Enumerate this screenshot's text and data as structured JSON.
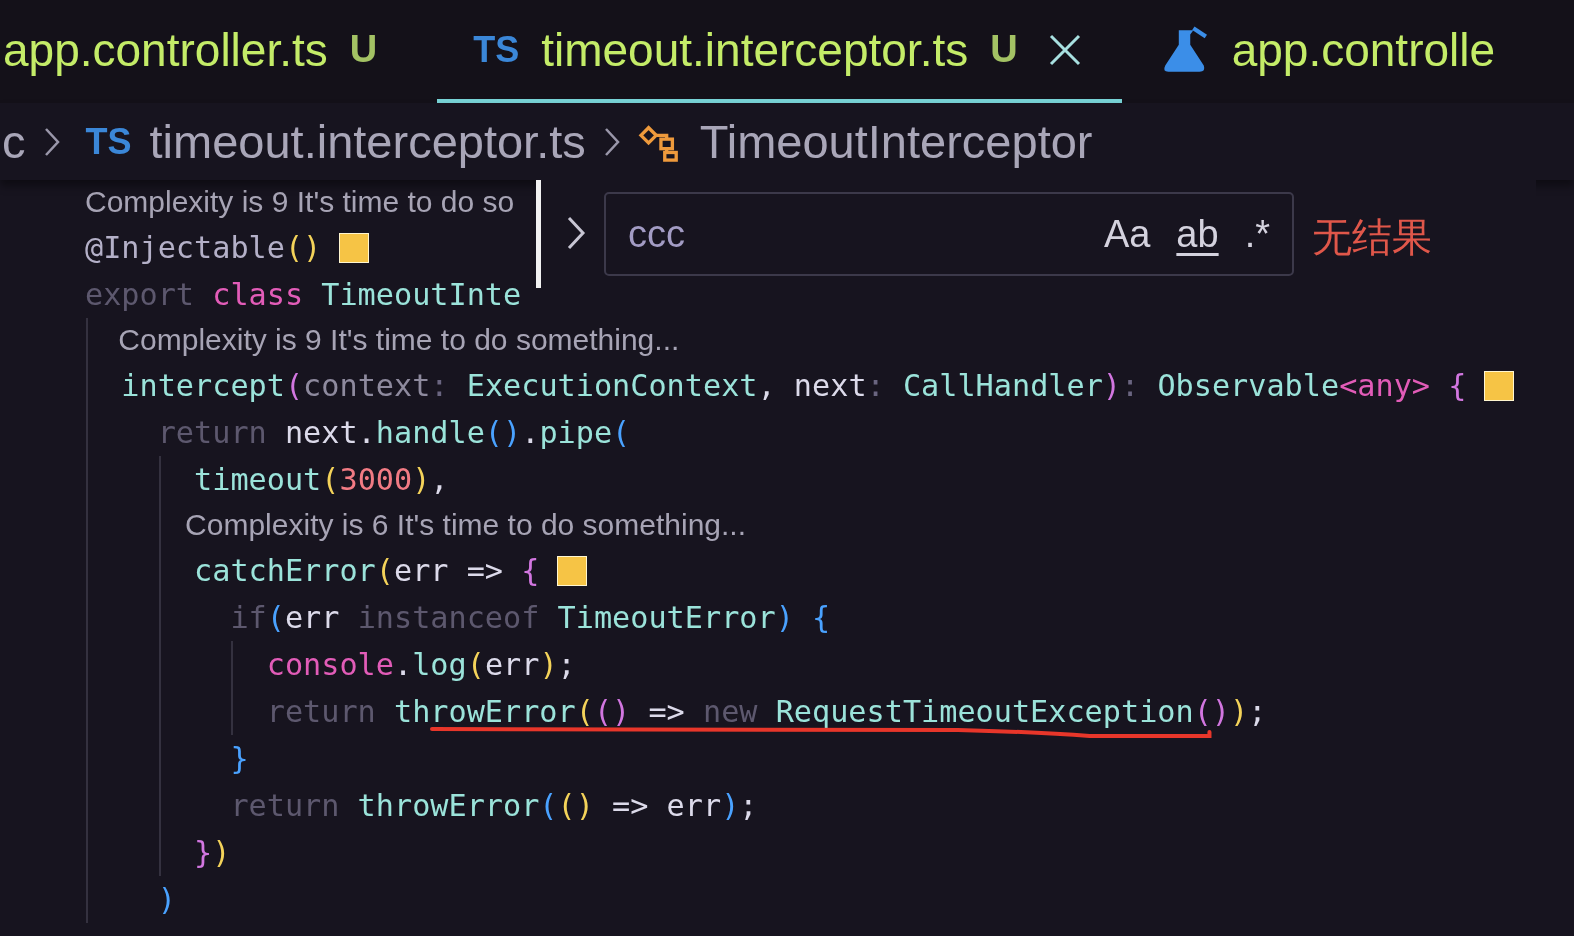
{
  "tabs": [
    {
      "label": "app.controller.ts",
      "badge": "U",
      "kind": "plain",
      "selected": false
    },
    {
      "label": "timeout.interceptor.ts",
      "badge": "U",
      "kind": "ts",
      "icon_text": "TS",
      "selected": true
    },
    {
      "label": "app.controlle",
      "kind": "spec",
      "selected": false
    }
  ],
  "breadcrumb": [
    {
      "text": "c",
      "kind": "plain"
    },
    {
      "text": "timeout.interceptor.ts",
      "kind": "ts",
      "icon_text": "TS"
    },
    {
      "text": "TimeoutInterceptor",
      "kind": "class"
    }
  ],
  "find_widget": {
    "query": "ccc",
    "options": [
      "Aa",
      "ab",
      ".*"
    ],
    "result": "无结果"
  },
  "lines": [
    {
      "kind": "codelens",
      "text": "Complexity is 9 It's time to do so"
    },
    {
      "kind": "code",
      "decoration": true,
      "underlined": false,
      "tokens": [
        {
          "t": "@Injectable",
          "kind": "decorator"
        },
        {
          "t": "()",
          "kind": "bracket1"
        }
      ]
    },
    {
      "kind": "code",
      "decoration": false,
      "underlined": false,
      "tokens": [
        {
          "t": "export",
          "kind": "keyword"
        },
        {
          "t": " class",
          "kind": "storage"
        },
        {
          "t": " TimeoutInte",
          "kind": "type"
        }
      ],
      "children": [
        {
          "kind": "codelens",
          "text": "Complexity is 9 It's time to do something..."
        },
        {
          "kind": "code",
          "decoration": true,
          "underlined": false,
          "tokens": [
            {
              "t": "intercept",
              "kind": "function"
            },
            {
              "t": "(",
              "kind": "bracket2"
            },
            {
              "t": "context",
              "kind": "parameter"
            },
            {
              "t": ":",
              "kind": "operator"
            },
            {
              "t": " ExecutionContext",
              "kind": "type"
            },
            {
              "t": ",",
              "kind": "punctuation"
            },
            {
              "t": " next",
              "kind": "variable"
            },
            {
              "t": ":",
              "kind": "operator"
            },
            {
              "t": " CallHandler",
              "kind": "type"
            },
            {
              "t": ")",
              "kind": "bracket2"
            },
            {
              "t": ":",
              "kind": "operator"
            },
            {
              "t": " Observable",
              "kind": "type"
            },
            {
              "t": "<any>",
              "kind": "storage"
            },
            {
              "t": " {",
              "kind": "bracket2"
            }
          ],
          "children": [
            {
              "kind": "code",
              "decoration": false,
              "underlined": false,
              "tokens": [
                {
                  "t": "return",
                  "kind": "keyword"
                },
                {
                  "t": " next",
                  "kind": "variable"
                },
                {
                  "t": ".",
                  "kind": "punctuation"
                },
                {
                  "t": "handle",
                  "kind": "function"
                },
                {
                  "t": "()",
                  "kind": "bracket3"
                },
                {
                  "t": ".",
                  "kind": "punctuation"
                },
                {
                  "t": "pipe",
                  "kind": "function"
                },
                {
                  "t": "(",
                  "kind": "bracket3"
                }
              ],
              "children": [
                {
                  "kind": "code",
                  "decoration": false,
                  "underlined": false,
                  "tokens": [
                    {
                      "t": "timeout",
                      "kind": "function"
                    },
                    {
                      "t": "(",
                      "kind": "bracket1"
                    },
                    {
                      "t": "3000",
                      "kind": "number"
                    },
                    {
                      "t": ")",
                      "kind": "bracket1"
                    },
                    {
                      "t": ",",
                      "kind": "punctuation"
                    }
                  ]
                },
                {
                  "kind": "codelens",
                  "text": "Complexity is 6 It's time to do something..."
                },
                {
                  "kind": "code",
                  "decoration": true,
                  "underlined": false,
                  "tokens": [
                    {
                      "t": "catchError",
                      "kind": "function"
                    },
                    {
                      "t": "(",
                      "kind": "bracket1"
                    },
                    {
                      "t": "err",
                      "kind": "variable"
                    },
                    {
                      "t": " =>",
                      "kind": "plain"
                    },
                    {
                      "t": " {",
                      "kind": "bracket2"
                    }
                  ],
                  "children": [
                    {
                      "kind": "code",
                      "decoration": false,
                      "underlined": false,
                      "tokens": [
                        {
                          "t": "if",
                          "kind": "keyword"
                        },
                        {
                          "t": "(",
                          "kind": "bracket3"
                        },
                        {
                          "t": "err",
                          "kind": "variable"
                        },
                        {
                          "t": " instanceof",
                          "kind": "keyword"
                        },
                        {
                          "t": " TimeoutError",
                          "kind": "type"
                        },
                        {
                          "t": ")",
                          "kind": "bracket3"
                        },
                        {
                          "t": " {",
                          "kind": "bracket3"
                        }
                      ],
                      "children": [
                        {
                          "kind": "code",
                          "decoration": false,
                          "underlined": false,
                          "tokens": [
                            {
                              "t": "console",
                              "kind": "storage"
                            },
                            {
                              "t": ".",
                              "kind": "punctuation"
                            },
                            {
                              "t": "log",
                              "kind": "function"
                            },
                            {
                              "t": "(",
                              "kind": "bracket1"
                            },
                            {
                              "t": "err",
                              "kind": "variable"
                            },
                            {
                              "t": ")",
                              "kind": "bracket1"
                            },
                            {
                              "t": ";",
                              "kind": "punctuation"
                            }
                          ]
                        },
                        {
                          "kind": "code",
                          "decoration": false,
                          "underlined": true,
                          "tokens": [
                            {
                              "t": "return",
                              "kind": "keyword"
                            },
                            {
                              "t": " throwError",
                              "kind": "function"
                            },
                            {
                              "t": "(",
                              "kind": "bracket1"
                            },
                            {
                              "t": "()",
                              "kind": "bracket2"
                            },
                            {
                              "t": " =>",
                              "kind": "plain"
                            },
                            {
                              "t": " new",
                              "kind": "keyword"
                            },
                            {
                              "t": " RequestTimeoutException",
                              "kind": "type"
                            },
                            {
                              "t": "()",
                              "kind": "bracket2"
                            },
                            {
                              "t": ")",
                              "kind": "bracket1"
                            },
                            {
                              "t": ";",
                              "kind": "punctuation"
                            }
                          ]
                        }
                      ]
                    },
                    {
                      "kind": "code",
                      "decoration": false,
                      "underlined": false,
                      "tokens": [
                        {
                          "t": "}",
                          "kind": "bracket3"
                        }
                      ]
                    },
                    {
                      "kind": "code",
                      "decoration": false,
                      "underlined": false,
                      "tokens": [
                        {
                          "t": "return",
                          "kind": "keyword"
                        },
                        {
                          "t": " throwError",
                          "kind": "function"
                        },
                        {
                          "t": "(",
                          "kind": "bracket3"
                        },
                        {
                          "t": "()",
                          "kind": "bracket1"
                        },
                        {
                          "t": " =>",
                          "kind": "plain"
                        },
                        {
                          "t": " err",
                          "kind": "variable"
                        },
                        {
                          "t": ")",
                          "kind": "bracket3"
                        },
                        {
                          "t": ";",
                          "kind": "punctuation"
                        }
                      ]
                    }
                  ]
                },
                {
                  "kind": "code",
                  "decoration": false,
                  "underlined": false,
                  "tokens": [
                    {
                      "t": "}",
                      "kind": "bracket2"
                    },
                    {
                      "t": ")",
                      "kind": "bracket1"
                    }
                  ]
                }
              ]
            },
            {
              "kind": "code",
              "decoration": false,
              "underlined": false,
              "tokens": [
                {
                  "t": ")",
                  "kind": "bracket3"
                }
              ]
            }
          ]
        }
      ]
    }
  ]
}
